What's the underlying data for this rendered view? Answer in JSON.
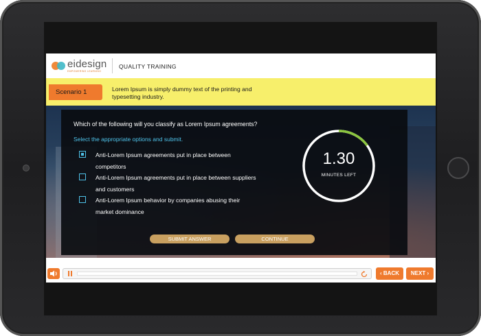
{
  "header": {
    "logo_text": "eidesign",
    "logo_tagline": "EMPOWERING LEARNING",
    "course_title": "QUALITY TRAINING"
  },
  "scenario": {
    "tag": "Scenario 1",
    "text": "Lorem Ipsum is simply dummy text of the printing and typesetting industry."
  },
  "question": {
    "prompt": "Which of the following will you classify as Lorem Ipsum agreements?",
    "instruction": "Select the appropriate options and submit.",
    "options": [
      {
        "text": "Anti-Lorem Ipsum agreements put in place between competitors",
        "checked": true
      },
      {
        "text": "Anti-Lorem Ipsum agreements put in place between suppliers and customers",
        "checked": false
      },
      {
        "text": "Anti-Lorem Ipsum behavior by companies abusing their market dominance",
        "checked": false
      }
    ]
  },
  "timer": {
    "value": "1.30",
    "label": "MINUTES LEFT",
    "remaining_fraction": 0.85
  },
  "buttons": {
    "submit": "SUBMIT ANSWER",
    "continue": "CONTINUE"
  },
  "controls": {
    "back": "BACK",
    "next": "NEXT",
    "progress": 0.0
  },
  "colors": {
    "accent_orange": "#ef7a2d",
    "scenario_yellow": "#f7ef6b",
    "instruction_blue": "#4fc3ea",
    "timer_green": "#8cc63f",
    "button_tan": "#c9a060"
  }
}
